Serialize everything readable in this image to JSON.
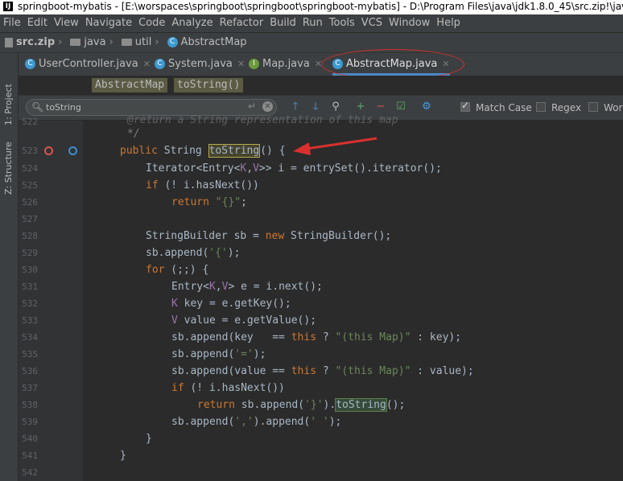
{
  "window": {
    "title": "springboot-mybatis - [E:\\worspaces\\springboot\\springboot\\springboot-mybatis] - D:\\Program Files\\java\\jdk1.8.0_45\\src.zip!\\java"
  },
  "menu": [
    "File",
    "Edit",
    "View",
    "Navigate",
    "Code",
    "Analyze",
    "Refactor",
    "Build",
    "Run",
    "Tools",
    "VCS",
    "Window",
    "Help"
  ],
  "breadcrumb": [
    "src.zip",
    "java",
    "util",
    "AbstractMap"
  ],
  "side_tabs": [
    "1: Project",
    "Z: Structure"
  ],
  "tabs": [
    {
      "label": "UserController.java",
      "icon": "class-icon"
    },
    {
      "label": "System.java",
      "icon": "class-icon"
    },
    {
      "label": "Map.java",
      "icon": "interface-icon"
    },
    {
      "label": "AbstractMap.java",
      "icon": "class-icon",
      "active": true
    }
  ],
  "nav": {
    "class_chip": "AbstractMap",
    "method_chip": "toString()"
  },
  "search": {
    "query": "toString",
    "options": [
      {
        "label": "Match Case",
        "checked": true
      },
      {
        "label": "Regex",
        "checked": false
      },
      {
        "label": "Words",
        "checked": false
      }
    ]
  },
  "code": {
    "line_numbers": [
      "522",
      "523",
      "524",
      "525",
      "526",
      "527",
      "528",
      "529",
      "530",
      "531",
      "532",
      "533",
      "534",
      "535",
      "536",
      "537",
      "538",
      "539",
      "540",
      "541",
      "542"
    ],
    "partial_top": "@return a String representation of this map",
    "comment_end": "*/",
    "tokens": {
      "public": "public",
      "string_type": "String",
      "method": "toString",
      "sig_tail": "() {",
      "iterator": "Iterator<Entry<",
      "K": "K",
      "comma": ",",
      "V": "V",
      "gt": ">> i = entrySet().iterator();",
      "if": "if",
      "not_has": " (! i.hasNext())",
      "return": "return",
      "empty_str": "\"{}\"",
      "semi": ";",
      "sb_decl": "StringBuilder sb = ",
      "new": "new",
      "sb_ctor": " StringBuilder();",
      "append_open": "sb.append(",
      "ch_open": "'{'",
      "close_semi": ");",
      "for": "for",
      "for_tail": " (;;) {",
      "entry": "Entry<",
      "entry_tail": "> e = i.next();",
      "key_line": " key = e.getKey();",
      "value_line": " value = e.getValue();",
      "append_key": "sb.append(key   == ",
      "this": "this",
      "q": " ? ",
      "this_map": "\"(this Map)\"",
      "key_tail": " : key);",
      "ch_eq": "'='",
      "append_value": "sb.append(value == ",
      "value_tail": " : value);",
      "if_has": " (! i.hasNext())",
      "ret_append": " sb.append(",
      "ch_close": "'}'",
      "dot": ").",
      "ret_tail": "();",
      "append_comma": "sb.append(",
      "ch_comma": "','",
      "mid": ").append(",
      "ch_space": "' '",
      "brace_close": "}"
    }
  },
  "colors": {
    "annotation": "#d9302e",
    "accent": "#4a88c7"
  }
}
